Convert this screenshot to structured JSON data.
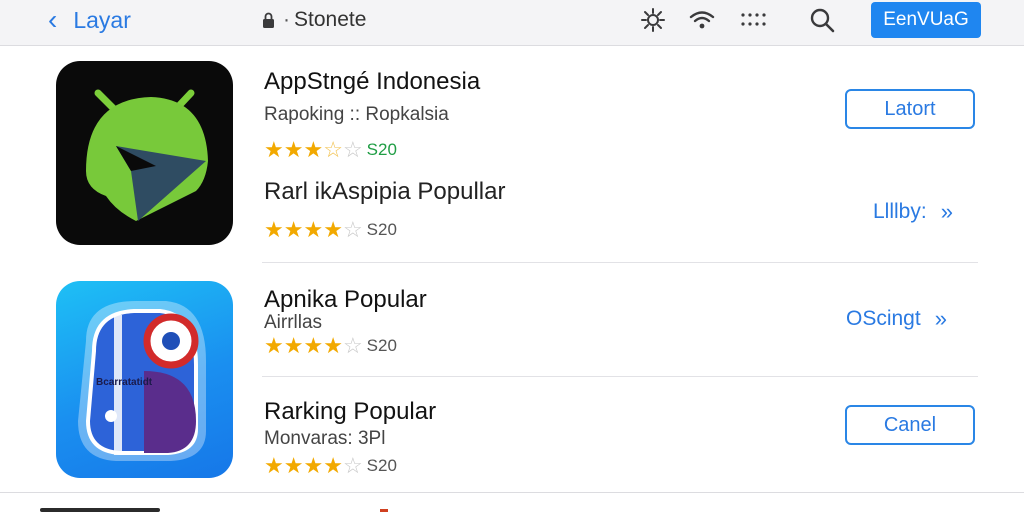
{
  "topbar": {
    "back_label": "Layar",
    "store_label": "Stonete",
    "action_label": "EenVUaG",
    "icons": [
      "settings-icon",
      "wifi-icon",
      "grid-dots-icon",
      "search-icon"
    ]
  },
  "apps": [
    {
      "title": "AppStngé Indonesia",
      "subtitle": "Rapoking :: Ropkalsia",
      "rating1": 3.5,
      "price1": "S20",
      "price1_color": "#1f9d44",
      "subtitle2": "Rarl ikAspipia Popullar",
      "rating2": 4,
      "price2": "S20",
      "button_label": "Latort",
      "link_label": "Llllby:"
    },
    {
      "title": "Apnika Popular",
      "subtitle": "Airrllas",
      "rating": 4,
      "price": "S20",
      "link_label": "OScingt",
      "icon_text": "Bcarratatidt"
    },
    {
      "title": "Rarking Popular",
      "subtitle": "Monvaras: 3Pl",
      "rating": 4,
      "price": "S20",
      "button_label": "Canel"
    }
  ],
  "colors": {
    "accent": "#2a7ae2",
    "star": "#f2a900",
    "primary_button": "#1f86f0"
  }
}
